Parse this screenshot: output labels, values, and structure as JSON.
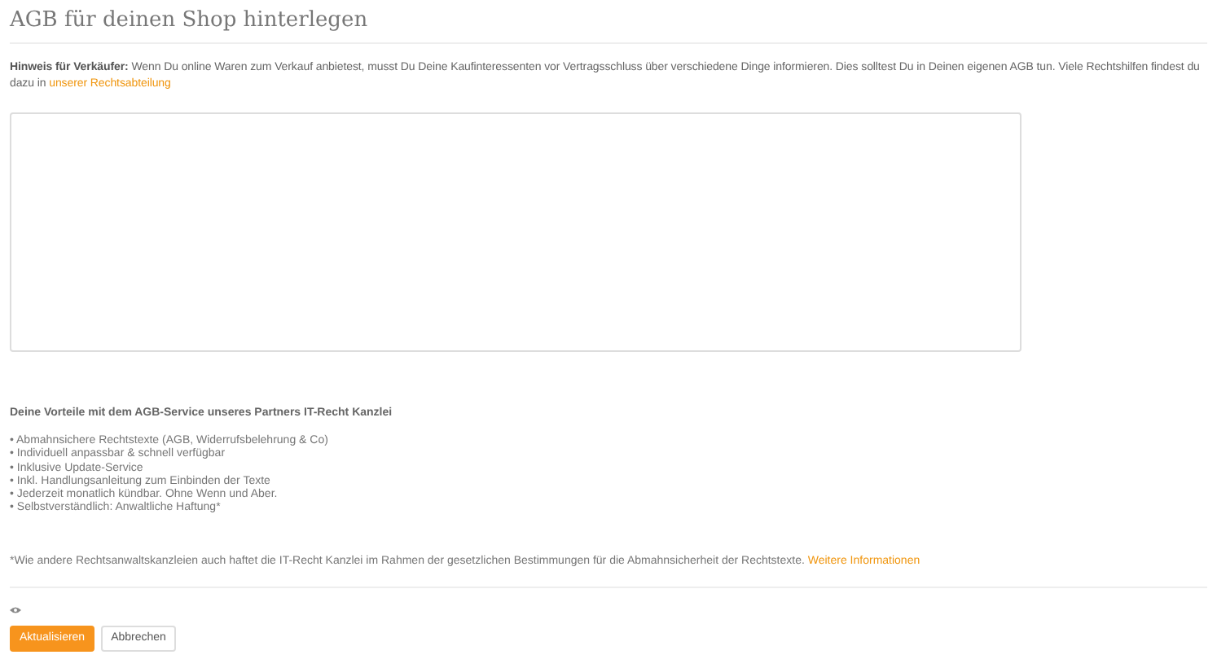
{
  "title": "AGB für deinen Shop hinterlegen",
  "hint": {
    "label": "Hinweis für Verkäufer:",
    "text": " Wenn Du online Waren zum Verkauf anbietest, musst Du Deine Kaufinteressenten vor Vertragsschluss über verschiedene Dinge informieren. Dies solltest Du in Deinen eigenen AGB tun. Viele Rechtshilfen findest du dazu in ",
    "link": "unserer Rechtsabteilung"
  },
  "benefits": {
    "heading": "Deine Vorteile mit dem AGB-Service unseres Partners IT-Recht Kanzlei",
    "items": [
      "• Abmahnsichere Rechtstexte (AGB, Widerrufsbelehrung & Co)",
      "• Individuell anpassbar & schnell verfügbar",
      "• Inklusive Update-Service",
      "• Inkl. Handlungsanleitung zum Einbinden der Texte",
      "• Jederzeit monatlich kündbar. Ohne Wenn und Aber.",
      "• Selbstverständlich: Anwaltliche Haftung*"
    ]
  },
  "footnote": {
    "text": "*Wie andere Rechtsanwaltskanzleien auch haftet die IT-Recht Kanzlei im Rahmen der gesetzlichen Bestimmungen für die Abmahnsicherheit der Rechtstexte.",
    "link": "Weitere Informationen"
  },
  "buttons": [
    {
      "label": "Aktualisieren",
      "kind": "primary"
    },
    {
      "label": "Abbrechen",
      "kind": "secondary"
    }
  ]
}
